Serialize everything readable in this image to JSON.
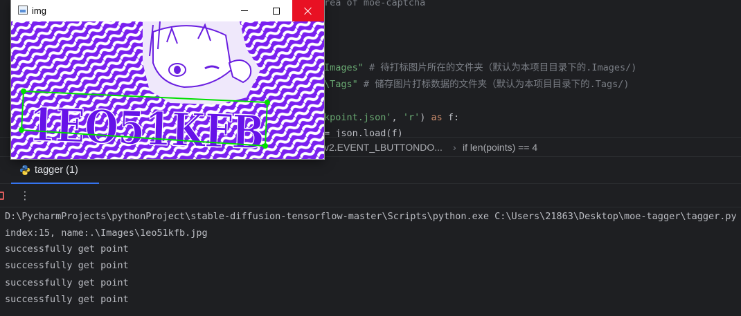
{
  "editor": {
    "lines": [
      {
        "parts": [
          {
            "cls": "com",
            "text": "rea of moe-captcha"
          }
        ]
      },
      {
        "parts": [
          {
            "cls": "str",
            "text": "Images\""
          },
          {
            "cls": "com",
            "text": " # 待打标图片所在的文件夹（默认为本项目目录下的.Images/)"
          }
        ]
      },
      {
        "parts": [
          {
            "cls": "str",
            "text": "\\Tags\""
          },
          {
            "cls": "com",
            "text": " # 储存图片打标数据的文件夹（默认为本项目目录下的.Tags/)"
          }
        ]
      },
      {
        "parts": [
          {
            "cls": "str",
            "text": "kpoint.json'"
          },
          {
            "cls": "plain",
            "text": ", "
          },
          {
            "cls": "str",
            "text": "'r'"
          },
          {
            "cls": "plain",
            "text": ") "
          },
          {
            "cls": "kw",
            "text": "as"
          },
          {
            "cls": "plain",
            "text": " f:"
          }
        ]
      },
      {
        "parts": [
          {
            "cls": "plain",
            "text": "= json.load(f)"
          }
        ]
      }
    ]
  },
  "breadcrumb": {
    "item1": "v2.EVENT_LBUTTONDO...",
    "separator": "›",
    "item2": "if len(points) == 4"
  },
  "run_panel": {
    "tab_label": "tagger (1)",
    "more_icon": "⋮"
  },
  "console": {
    "lines": [
      "D:\\PycharmProjects\\pythonProject\\stable-diffusion-tensorflow-master\\Scripts\\python.exe C:\\Users\\21863\\Desktop\\moe-tagger\\tagger.py",
      "index:15, name:.\\Images\\1eo51kfb.jpg",
      "successfully get point",
      "successfully get point",
      "successfully get point",
      "successfully get point"
    ]
  },
  "img_window": {
    "title": "img",
    "captcha_text": "1EO51KFB",
    "accent_purple": "#7a20f0",
    "box_color": "#00e000"
  },
  "colors": {
    "string": "#6aab73",
    "comment": "#7a7e85",
    "keyword": "#cf8e6d",
    "close_button": "#e81123"
  }
}
